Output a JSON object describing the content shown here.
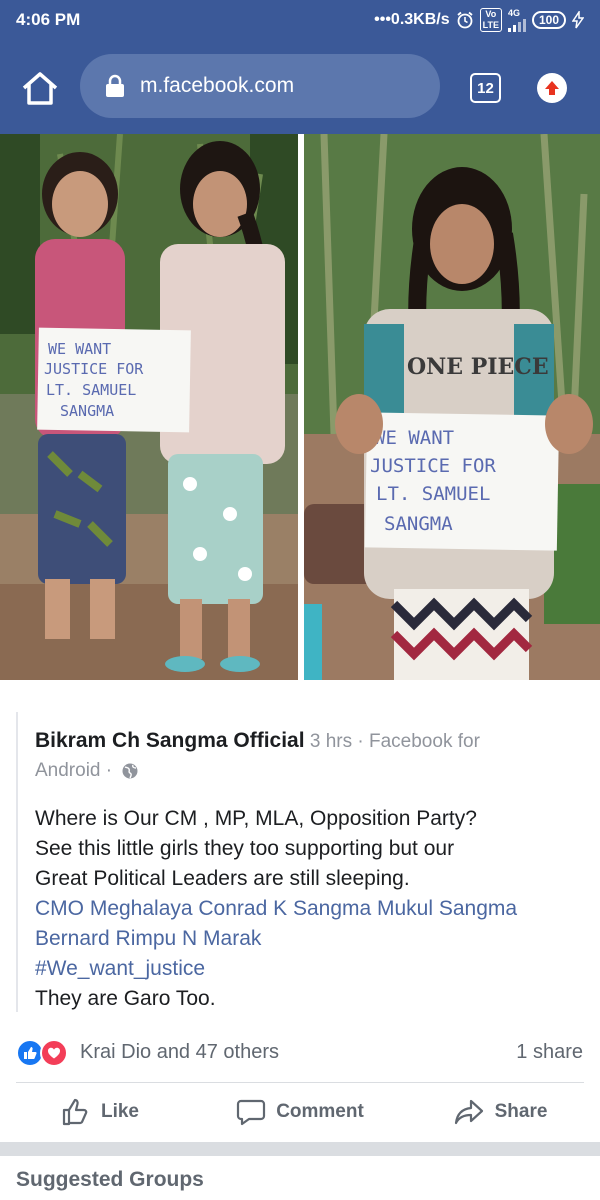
{
  "status_bar": {
    "time": "4:06 PM",
    "network_speed": "•••0.3KB/s",
    "volte_label": "Vo\nLTE",
    "network_type": "4G",
    "battery": "100",
    "icons": [
      "alarm-icon",
      "volte-icon",
      "signal-icon",
      "battery-icon",
      "charging-icon"
    ]
  },
  "browser": {
    "url": "m.facebook.com",
    "tab_count": "12",
    "icons": [
      "home-icon",
      "lock-icon",
      "update-icon"
    ],
    "colors": {
      "bar": "#3b5998",
      "pill": "#5c77ad"
    }
  },
  "photos": [
    {
      "sign_text": [
        "WE WANT",
        "JUSTICE FOR",
        "LT. SAMUEL",
        "SANGMA"
      ]
    },
    {
      "sign_text": [
        "WE WANT",
        "JUSTICE FOR",
        "LT. SAMUEL",
        "SANGMA"
      ],
      "shirt_text": "ONE PIECE"
    }
  ],
  "post": {
    "author": "Bikram Ch Sangma Official",
    "time": "3 hrs",
    "separator": "·",
    "source_line1": "Facebook for",
    "source_line2": "Android ·",
    "body_lines": [
      "Where is Our CM , MP, MLA, Opposition Party?",
      "See this little girls they too supporting but our",
      "Great Political Leaders are still sleeping."
    ],
    "links_line1": "CMO Meghalaya Conrad K Sangma Mukul Sangma",
    "links_line2": "Bernard Rimpu N Marak",
    "hashtag": "#We_want_justice",
    "closing": "They are Garo Too."
  },
  "reactions": {
    "names": "Krai Dio and 47 others",
    "shares": "1 share"
  },
  "actions": {
    "like": "Like",
    "comment": "Comment",
    "share": "Share"
  },
  "suggested_title": "Suggested Groups"
}
